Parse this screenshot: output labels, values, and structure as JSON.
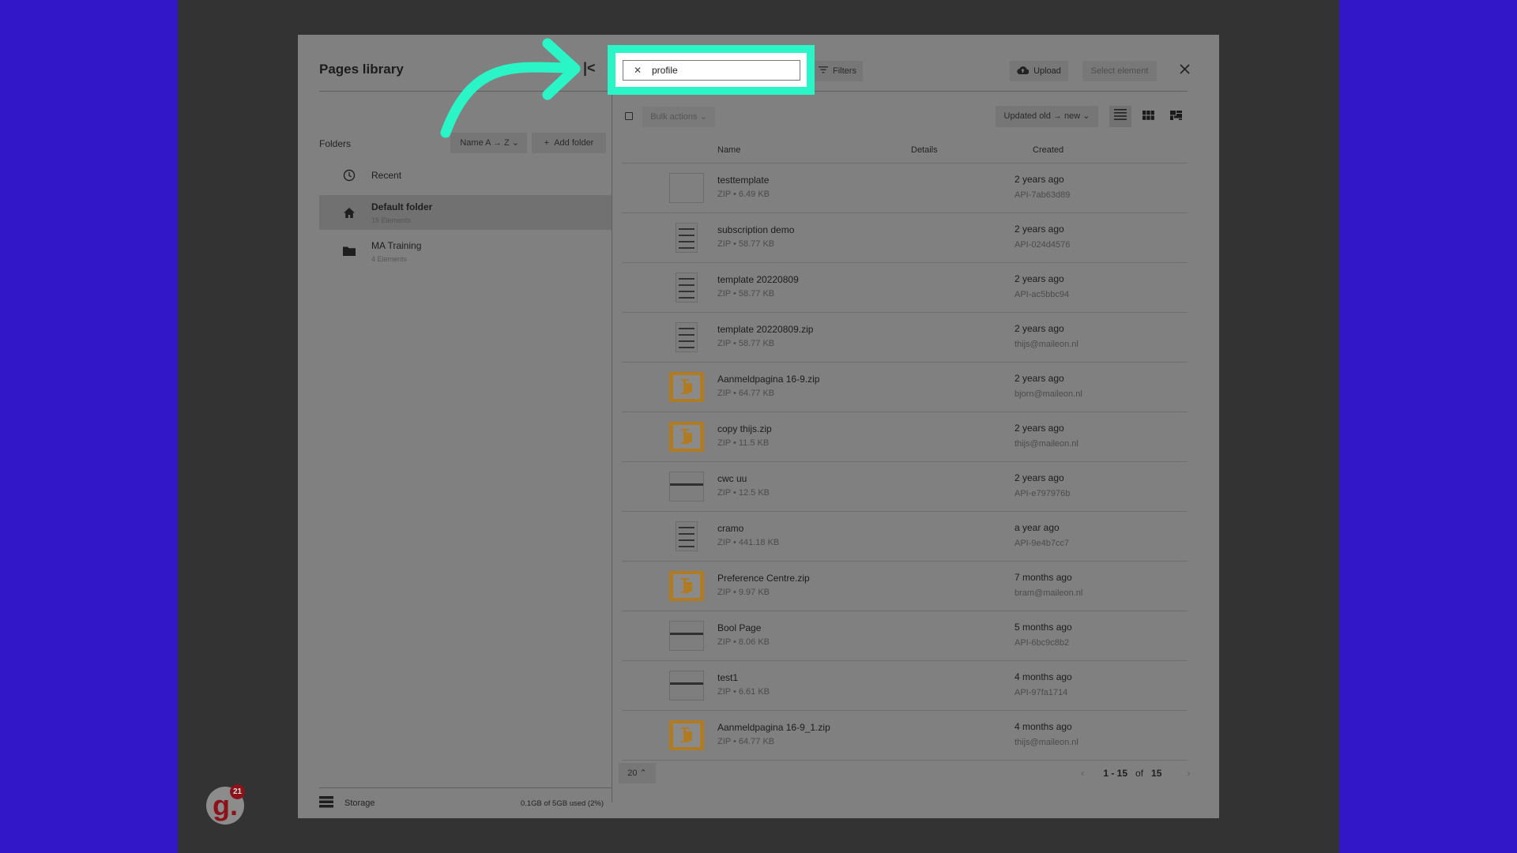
{
  "modal": {
    "title": "Pages library",
    "collapse_icon": "collapse-left-icon",
    "folders_label": "Folders",
    "folder_sort_label": "Name A → Z",
    "add_folder_label": "Add folder",
    "folders": [
      {
        "name": "Recent",
        "count": "",
        "icon": "clock-icon",
        "selected": false
      },
      {
        "name": "Default folder",
        "count": "15 Elements",
        "icon": "home-icon",
        "selected": true
      },
      {
        "name": "MA Training",
        "count": "4 Elements",
        "icon": "folder-icon",
        "selected": false
      }
    ],
    "storage": {
      "label": "Storage",
      "used": "0.1GB of 5GB used (2%)",
      "used_percent": 2
    }
  },
  "toolbar": {
    "search_value": "profile",
    "search_clear_icon": "close-icon",
    "filters_label": "Filters",
    "upload_label": "Upload",
    "select_element_label": "Select element",
    "bulk_actions_label": "Bulk actions",
    "sort_label": "Updated old → new",
    "views": [
      "list-view-icon",
      "grid-view-icon",
      "mosaic-view-icon"
    ],
    "active_view": "list"
  },
  "table": {
    "columns": [
      "Name",
      "Details",
      "Created"
    ],
    "rows": [
      {
        "name": "testtemplate",
        "meta": "ZIP • 6.49 KB",
        "when": "2 years ago",
        "who": "API-7ab63d89",
        "thumb": "blank"
      },
      {
        "name": "subscription demo",
        "meta": "ZIP • 58.77 KB",
        "when": "2 years ago",
        "who": "API-024d4576",
        "thumb": "page"
      },
      {
        "name": "template 20220809",
        "meta": "ZIP • 58.77 KB",
        "when": "2 years ago",
        "who": "API-ac5bbc94",
        "thumb": "page"
      },
      {
        "name": "template 20220809.zip",
        "meta": "ZIP • 58.77 KB",
        "when": "2 years ago",
        "who": "thijs@maileon.nl",
        "thumb": "page"
      },
      {
        "name": "Aanmeldpagina 16-9.zip",
        "meta": "ZIP • 64.77 KB",
        "when": "2 years ago",
        "who": "bjorn@maileon.nl",
        "thumb": "zip"
      },
      {
        "name": "copy thijs.zip",
        "meta": "ZIP • 11.5 KB",
        "when": "2 years ago",
        "who": "thijs@maileon.nl",
        "thumb": "zip"
      },
      {
        "name": "cwc uu",
        "meta": "ZIP • 12.5 KB",
        "when": "2 years ago",
        "who": "API-e797976b",
        "thumb": "screenshot"
      },
      {
        "name": "cramo",
        "meta": "ZIP • 441.18 KB",
        "when": "a year ago",
        "who": "API-9e4b7cc7",
        "thumb": "page"
      },
      {
        "name": "Preference Centre.zip",
        "meta": "ZIP • 9.97 KB",
        "when": "7 months ago",
        "who": "bram@maileon.nl",
        "thumb": "zip"
      },
      {
        "name": "Bool Page",
        "meta": "ZIP • 8.06 KB",
        "when": "5 months ago",
        "who": "API-6bc9c8b2",
        "thumb": "screenshot"
      },
      {
        "name": "test1",
        "meta": "ZIP • 6.61 KB",
        "when": "4 months ago",
        "who": "API-97fa1714",
        "thumb": "screenshot"
      },
      {
        "name": "Aanmeldpagina 16-9_1.zip",
        "meta": "ZIP • 64.77 KB",
        "when": "4 months ago",
        "who": "thijs@maileon.nl",
        "thumb": "zip"
      }
    ]
  },
  "pagination": {
    "per_page": "20",
    "range": "1 - 15",
    "of_label": "of",
    "total": "15"
  },
  "overlay": {
    "highlight_color": "#2af5c6",
    "app_badge_letter": "g.",
    "app_badge_count": "21"
  }
}
